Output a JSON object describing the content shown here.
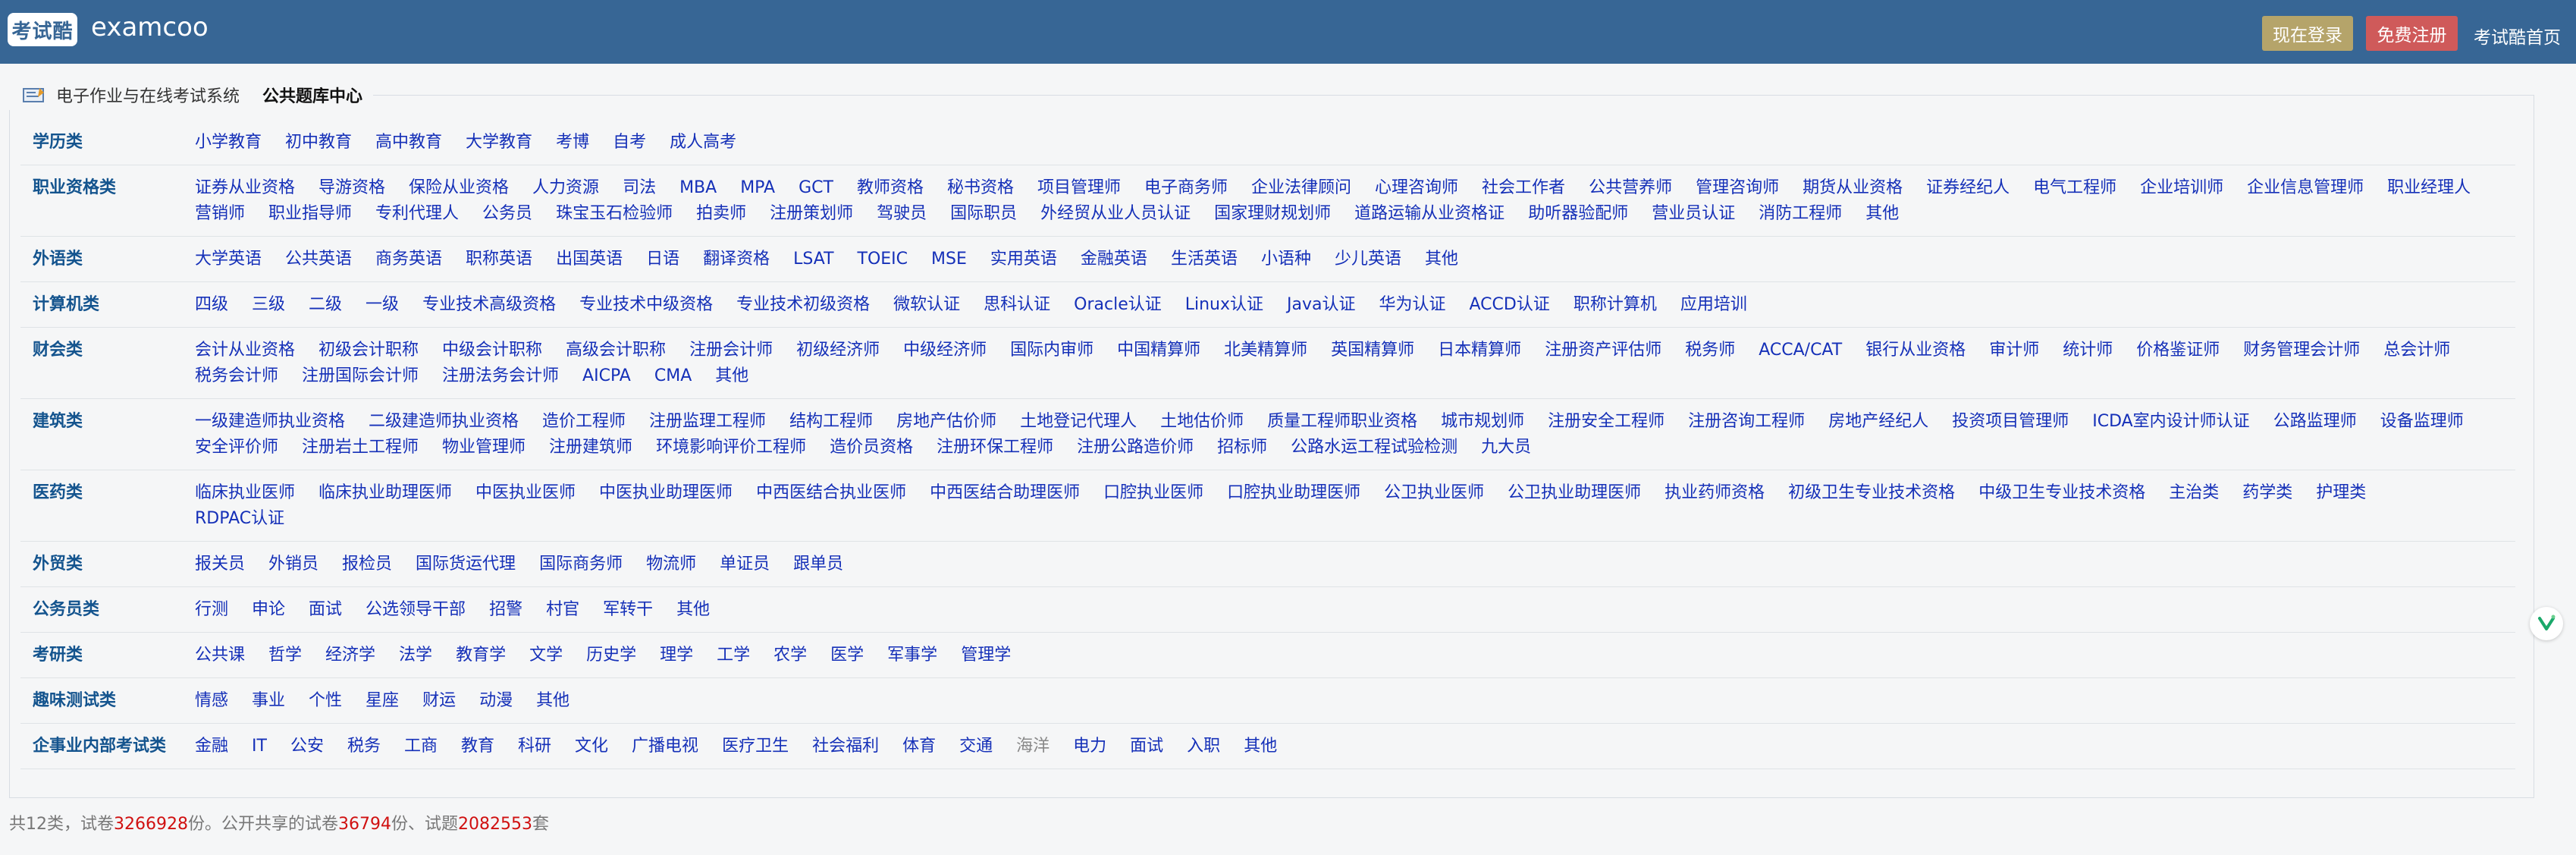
{
  "header": {
    "logo_badge": "考试酷",
    "logo_text": "examcoo",
    "login_label": "现在登录",
    "register_label": "免费注册",
    "site_link": "考试酷首页",
    "colors": {
      "bar": "#376695",
      "login": "#b5a46a",
      "register": "#cf5a5a"
    }
  },
  "panel": {
    "legend_link": "电子作业与在线考试系统",
    "legend_current": "公共题库中心"
  },
  "categories": [
    {
      "name": "学历类",
      "items": [
        "小学教育",
        "初中教育",
        "高中教育",
        "大学教育",
        "考博",
        "自考",
        "成人高考"
      ]
    },
    {
      "name": "职业资格类",
      "items": [
        "证券从业资格",
        "导游资格",
        "保险从业资格",
        "人力资源",
        "司法",
        "MBA",
        "MPA",
        "GCT",
        "教师资格",
        "秘书资格",
        "项目管理师",
        "电子商务师",
        "企业法律顾问",
        "心理咨询师",
        "社会工作者",
        "公共营养师",
        "管理咨询师",
        "期货从业资格",
        "证券经纪人",
        "电气工程师",
        "企业培训师",
        "企业信息管理师",
        "职业经理人",
        "营销师",
        "职业指导师",
        "专利代理人",
        "公务员",
        "珠宝玉石检验师",
        "拍卖师",
        "注册策划师",
        "驾驶员",
        "国际职员",
        "外经贸从业人员认证",
        "国家理财规划师",
        "道路运输从业资格证",
        "助听器验配师",
        "营业员认证",
        "消防工程师",
        "其他"
      ]
    },
    {
      "name": "外语类",
      "items": [
        "大学英语",
        "公共英语",
        "商务英语",
        "职称英语",
        "出国英语",
        "日语",
        "翻译资格",
        "LSAT",
        "TOEIC",
        "MSE",
        "实用英语",
        "金融英语",
        "生活英语",
        "小语种",
        "少儿英语",
        "其他"
      ]
    },
    {
      "name": "计算机类",
      "items": [
        "四级",
        "三级",
        "二级",
        "一级",
        "专业技术高级资格",
        "专业技术中级资格",
        "专业技术初级资格",
        "微软认证",
        "思科认证",
        "Oracle认证",
        "Linux认证",
        "Java认证",
        "华为认证",
        "ACCD认证",
        "职称计算机",
        "应用培训"
      ]
    },
    {
      "name": "财会类",
      "items": [
        "会计从业资格",
        "初级会计职称",
        "中级会计职称",
        "高级会计职称",
        "注册会计师",
        "初级经济师",
        "中级经济师",
        "国际内审师",
        "中国精算师",
        "北美精算师",
        "英国精算师",
        "日本精算师",
        "注册资产评估师",
        "税务师",
        "ACCA/CAT",
        "银行从业资格",
        "审计师",
        "统计师",
        "价格鉴证师",
        "财务管理会计师",
        "总会计师",
        "税务会计师",
        "注册国际会计师",
        "注册法务会计师",
        "AICPA",
        "CMA",
        "其他"
      ]
    },
    {
      "name": "建筑类",
      "items": [
        "一级建造师执业资格",
        "二级建造师执业资格",
        "造价工程师",
        "注册监理工程师",
        "结构工程师",
        "房地产估价师",
        "土地登记代理人",
        "土地估价师",
        "质量工程师职业资格",
        "城市规划师",
        "注册安全工程师",
        "注册咨询工程师",
        "房地产经纪人",
        "投资项目管理师",
        "ICDA室内设计师认证",
        "公路监理师",
        "设备监理师",
        "安全评价师",
        "注册岩土工程师",
        "物业管理师",
        "注册建筑师",
        "环境影响评价工程师",
        "造价员资格",
        "注册环保工程师",
        "注册公路造价师",
        "招标师",
        "公路水运工程试验检测",
        "九大员"
      ]
    },
    {
      "name": "医药类",
      "items": [
        "临床执业医师",
        "临床执业助理医师",
        "中医执业医师",
        "中医执业助理医师",
        "中西医结合执业医师",
        "中西医结合助理医师",
        "口腔执业医师",
        "口腔执业助理医师",
        "公卫执业医师",
        "公卫执业助理医师",
        "执业药师资格",
        "初级卫生专业技术资格",
        "中级卫生专业技术资格",
        "主治类",
        "药学类",
        "护理类",
        "RDPAC认证"
      ]
    },
    {
      "name": "外贸类",
      "items": [
        "报关员",
        "外销员",
        "报检员",
        "国际货运代理",
        "国际商务师",
        "物流师",
        "单证员",
        "跟单员"
      ]
    },
    {
      "name": "公务员类",
      "items": [
        "行测",
        "申论",
        "面试",
        "公选领导干部",
        "招警",
        "村官",
        "军转干",
        "其他"
      ]
    },
    {
      "name": "考研类",
      "items": [
        "公共课",
        "哲学",
        "经济学",
        "法学",
        "教育学",
        "文学",
        "历史学",
        "理学",
        "工学",
        "农学",
        "医学",
        "军事学",
        "管理学"
      ]
    },
    {
      "name": "趣味测试类",
      "items": [
        "情感",
        "事业",
        "个性",
        "星座",
        "财运",
        "动漫",
        "其他"
      ]
    },
    {
      "name": "企事业内部考试类",
      "items": [
        "金融",
        "IT",
        "公安",
        "税务",
        "工商",
        "教育",
        "科研",
        "文化",
        "广播电视",
        "医疗卫生",
        "社会福利",
        "体育",
        "交通",
        "海洋",
        "电力",
        "面试",
        "入职",
        "其他"
      ],
      "muted_items": [
        "海洋"
      ]
    }
  ],
  "summary": {
    "prefix": "共12类，试卷",
    "papers": "3266928",
    "mid1": "份。公开共享的试卷",
    "shared": "36794",
    "mid2": "份、试题",
    "questions": "2082553",
    "suffix": "套"
  }
}
